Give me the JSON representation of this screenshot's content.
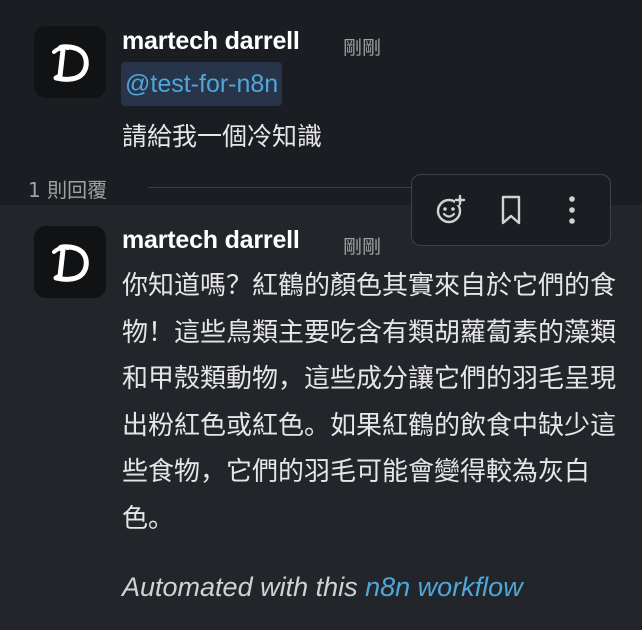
{
  "colors": {
    "background": "#1a1d21",
    "reply_background": "#222529",
    "link": "#4ea6db",
    "mention_bg": "#27344a",
    "text": "#e6e6e6",
    "muted": "#a0a1a3"
  },
  "message": {
    "sender": "martech darrell",
    "time": "剛剛",
    "mention": "@test-for-n8n",
    "text": "請給我一個冷知識",
    "avatar_icon": "n8n-d-logo"
  },
  "thread": {
    "reply_count_label": "1 則回覆"
  },
  "toolbar": {
    "icons": [
      "add-reaction-icon",
      "bookmark-icon",
      "more-options-icon"
    ]
  },
  "reply": {
    "sender": "martech darrell",
    "time": "剛剛",
    "text": "你知道嗎？紅鶴的顏色其實來自於它們的食物！這些鳥類主要吃含有類胡蘿蔔素的藻類和甲殼類動物，這些成分讓它們的羽毛呈現出粉紅色或紅色。如果紅鶴的飲食中缺少這些食物，它們的羽毛可能會變得較為灰白色。",
    "footer_prefix": "Automated with this ",
    "footer_link": "n8n workflow",
    "avatar_icon": "n8n-d-logo"
  }
}
